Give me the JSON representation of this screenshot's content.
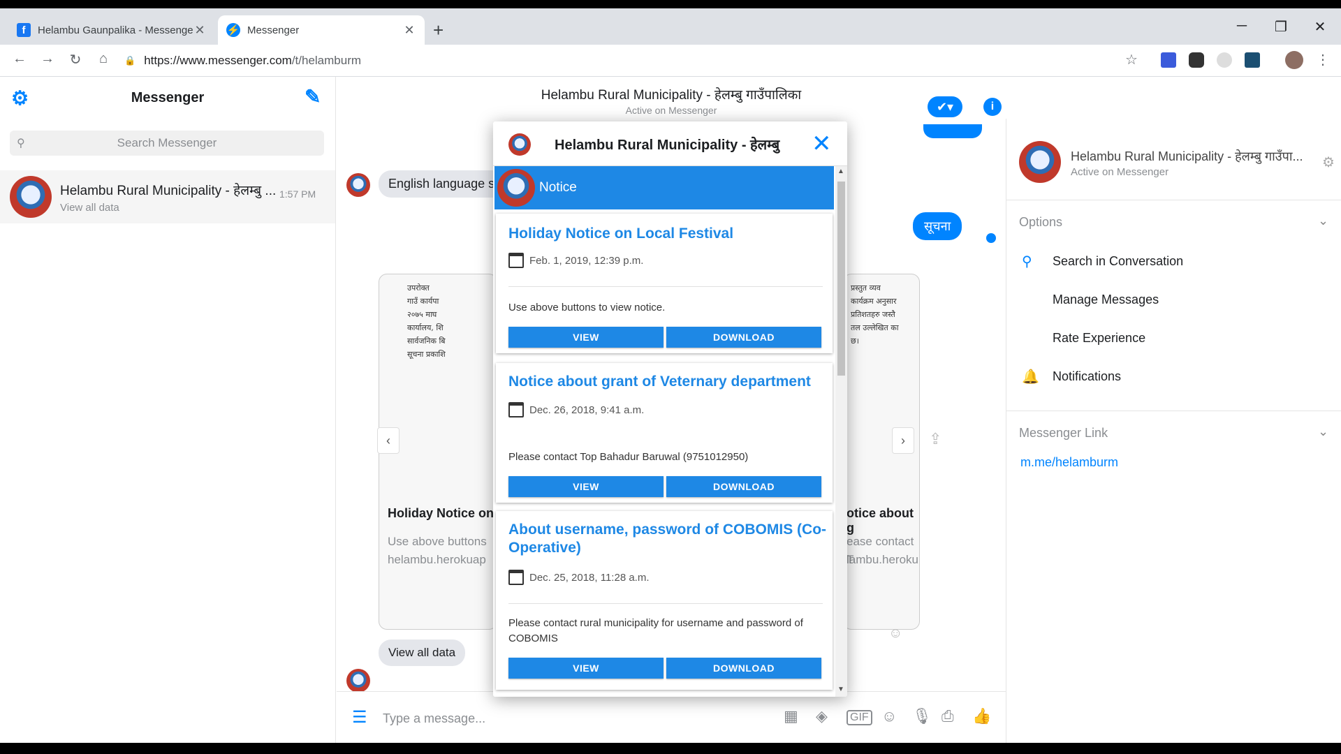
{
  "browser": {
    "tabs": [
      {
        "title": "Helambu Gaunpalika - Messenger",
        "icon": "facebook-icon"
      },
      {
        "title": "Messenger",
        "icon": "messenger-icon"
      }
    ],
    "url_prefix": "https://www.messenger.com",
    "url_path": "/t/helamburm"
  },
  "left": {
    "title": "Messenger",
    "search_placeholder": "Search Messenger",
    "conversation": {
      "name": "Helambu Rural Municipality - हेलम्बु ...",
      "snippet": "View all data",
      "time": "1:57 PM"
    }
  },
  "chat": {
    "header_title": "Helambu Rural Municipality - हेलम्बु गाउँपालिका",
    "header_sub": "Active on Messenger",
    "msg_english": "English language se",
    "msg_suchana": "सूचना",
    "card_left_caption": "Holiday Notice on",
    "card_left_line1": "Use above buttons",
    "card_left_line2": "helambu.herokuap",
    "card_right_caption": "otice about g",
    "card_right_line1": "ease contact T",
    "card_right_line2": "lambu.heroku",
    "doc_left": "उपरोक्त\nगाउँ कार्यपा\n२०७५ माघ\nकार्यालय, शि\nसार्वजनिक बि\nसूचना प्रकाशि",
    "doc_right": "प्रस्तुत व्यव\nकार्यक्रम अनुसार\nप्रतिशतहरु जस्तै\nतल उल्लेखित का\nछ।",
    "view_all": "View all data",
    "composer_placeholder": "Type a message..."
  },
  "right": {
    "name": "Helambu Rural Municipality - हेलम्बु गाउँपा...",
    "sub": "Active on Messenger",
    "options_title": "Options",
    "options": [
      "Search in Conversation",
      "Manage Messages",
      "Rate Experience",
      "Notifications"
    ],
    "link_title": "Messenger Link",
    "link": "m.me/helamburm"
  },
  "modal": {
    "title": "Helambu Rural Municipality - हेलम्बु",
    "section": "Notice",
    "notices": [
      {
        "title": "Holiday Notice on Local Festival",
        "date": "Feb. 1, 2019, 12:39 p.m.",
        "text": "Use above buttons to view notice.",
        "view": "VIEW",
        "download": "DOWNLOAD"
      },
      {
        "title": "Notice about grant of Veternary department",
        "date": "Dec. 26, 2018, 9:41 a.m.",
        "text": "Please contact Top Bahadur Baruwal (9751012950)",
        "view": "VIEW",
        "download": "DOWNLOAD"
      },
      {
        "title": "About username, password of COBOMIS (Co-Operative)",
        "date": "Dec. 25, 2018, 11:28 a.m.",
        "text": "Please contact rural municipality for username and password of COBOMIS",
        "view": "VIEW",
        "download": "DOWNLOAD"
      }
    ]
  },
  "colors": {
    "accent": "#0084ff",
    "notice_blue": "#1e88e5"
  }
}
